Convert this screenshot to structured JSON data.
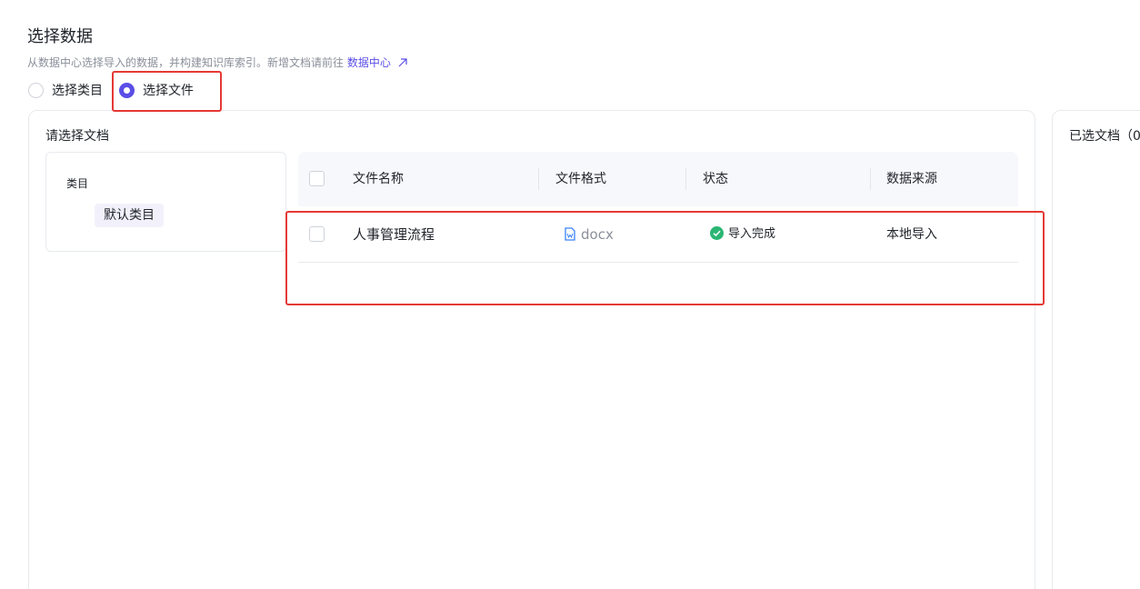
{
  "header": {
    "title": "选择数据",
    "description": "从数据中心选择导入的数据，并构建知识库索引。新增文档请前往",
    "link_label": "数据中心"
  },
  "mode": {
    "options": [
      {
        "label": "选择类目",
        "checked": false
      },
      {
        "label": "选择文件",
        "checked": true
      }
    ]
  },
  "left_panel": {
    "title": "请选择文档",
    "category_label": "类目",
    "categories": [
      "默认类目"
    ]
  },
  "table": {
    "columns": [
      "文件名称",
      "文件格式",
      "状态",
      "数据来源"
    ],
    "rows": [
      {
        "name": "人事管理流程",
        "format": "docx",
        "status": "导入完成",
        "source": "本地导入"
      }
    ]
  },
  "right_panel": {
    "title": "已选文档（0"
  },
  "colors": {
    "accent": "#5b4ee6",
    "success": "#2bb673",
    "highlight": "#e53935",
    "doc_icon": "#3b82f6"
  }
}
